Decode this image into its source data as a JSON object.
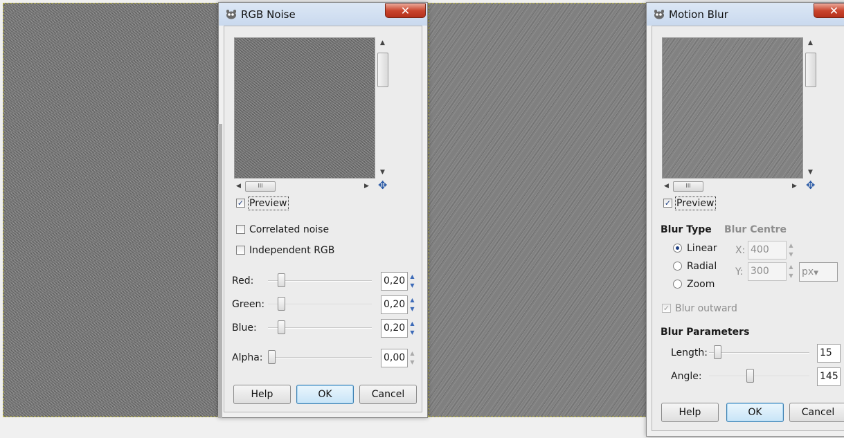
{
  "rgb_noise": {
    "title": "RGB Noise",
    "close_glyph": "✕",
    "preview_label": "Preview",
    "preview_checked": true,
    "correlated_label": "Correlated noise",
    "correlated_checked": false,
    "independent_label": "Independent RGB",
    "independent_checked": false,
    "sliders": [
      {
        "label": "Red:",
        "value": "0,20",
        "level": 0.2
      },
      {
        "label": "Green:",
        "value": "0,20",
        "level": 0.2
      },
      {
        "label": "Blue:",
        "value": "0,20",
        "level": 0.2
      },
      {
        "label": "Alpha:",
        "value": "0,00",
        "level": 0.0
      }
    ],
    "buttons": {
      "help": "Help",
      "ok": "OK",
      "cancel": "Cancel"
    },
    "hscroll_grip": "III"
  },
  "motion_blur": {
    "title": "Motion Blur",
    "close_glyph": "✕",
    "preview_label": "Preview",
    "preview_checked": true,
    "blur_type_heading": "Blur Type",
    "blur_centre_heading": "Blur Centre",
    "blur_types": [
      {
        "label": "Linear",
        "selected": true
      },
      {
        "label": "Radial",
        "selected": false
      },
      {
        "label": "Zoom",
        "selected": false
      }
    ],
    "centre_x_label": "X:",
    "centre_x_value": "400",
    "centre_y_label": "Y:",
    "centre_y_value": "300",
    "unit": "px",
    "blur_outward_label": "Blur outward",
    "blur_outward_checked": true,
    "params_heading": "Blur Parameters",
    "length_label": "Length:",
    "length_value": "15",
    "length_level": 0.05,
    "angle_label": "Angle:",
    "angle_value": "145",
    "angle_level": 0.4,
    "buttons": {
      "help": "Help",
      "ok": "OK",
      "cancel": "Cancel"
    },
    "hscroll_grip": "III"
  },
  "colors": {
    "accent": "#3c7fb1",
    "close_red": "#c9442d",
    "selection_dash": "#c9c13a"
  }
}
